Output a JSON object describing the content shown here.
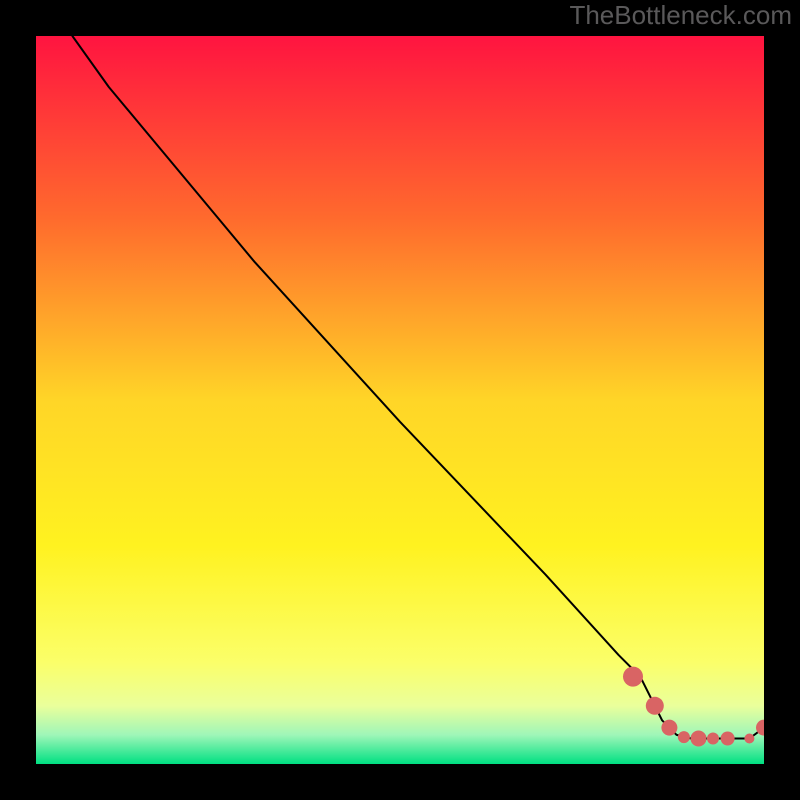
{
  "attribution": "TheBottleneck.com",
  "chart_data": {
    "type": "line",
    "title": "",
    "xlabel": "",
    "ylabel": "",
    "xlim": [
      0,
      100
    ],
    "ylim": [
      0,
      100
    ],
    "background": {
      "gradient_stops": [
        {
          "offset": 0,
          "color": "#ff1440"
        },
        {
          "offset": 0.25,
          "color": "#ff6a2d"
        },
        {
          "offset": 0.5,
          "color": "#ffd527"
        },
        {
          "offset": 0.7,
          "color": "#fff220"
        },
        {
          "offset": 0.86,
          "color": "#fbff69"
        },
        {
          "offset": 0.92,
          "color": "#eaff9b"
        },
        {
          "offset": 0.96,
          "color": "#9ff6b8"
        },
        {
          "offset": 1.0,
          "color": "#00e082"
        }
      ]
    },
    "series": [
      {
        "name": "bottleneck-curve",
        "color": "#000000",
        "stroke_width": 2,
        "x": [
          5,
          10,
          25,
          30,
          50,
          70,
          80,
          83,
          86,
          88,
          90,
          92,
          94,
          96,
          98,
          100
        ],
        "values": [
          100,
          93,
          75,
          69,
          47,
          26,
          15,
          12,
          6,
          4,
          3.5,
          3.5,
          3.5,
          3.5,
          3.5,
          5
        ]
      }
    ],
    "highlight_points": {
      "name": "sweet-spot",
      "color": "#d96464",
      "x": [
        82,
        85,
        87,
        89,
        91,
        93,
        95,
        98,
        100
      ],
      "values": [
        12,
        8,
        5,
        3.7,
        3.5,
        3.5,
        3.5,
        3.5,
        5
      ],
      "sizes": [
        10,
        9,
        8,
        6,
        8,
        6,
        7,
        5,
        8
      ]
    }
  }
}
